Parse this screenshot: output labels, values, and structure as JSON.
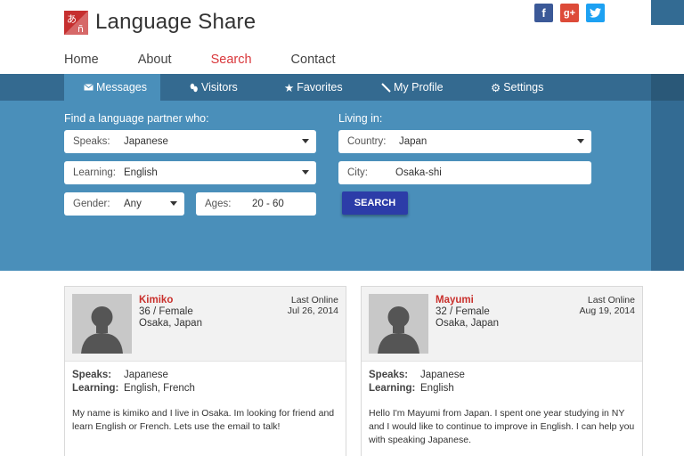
{
  "header": {
    "app_title": "Language Share",
    "logo_glyphs": {
      "top": "あ",
      "bottom": "ñ"
    },
    "social": [
      {
        "name": "facebook-icon",
        "glyph": "f"
      },
      {
        "name": "google-plus-icon",
        "glyph": "g+"
      },
      {
        "name": "twitter-icon",
        "glyph": "t"
      }
    ]
  },
  "topnav": [
    {
      "label": "Home"
    },
    {
      "label": "About"
    },
    {
      "label": "Search"
    },
    {
      "label": "Contact"
    }
  ],
  "tabs": [
    {
      "label": "Messages",
      "icon": "envelope-icon"
    },
    {
      "label": "Visitors",
      "icon": "footprints-icon"
    },
    {
      "label": "Favorites",
      "icon": "star-icon"
    },
    {
      "label": "My Profile",
      "icon": "pencil-icon"
    },
    {
      "label": "Settings",
      "icon": "gear-icon"
    }
  ],
  "search": {
    "find_label": "Find a language partner who:",
    "living_label": "Living in:",
    "speaks": {
      "label": "Speaks:",
      "value": "Japanese"
    },
    "learning": {
      "label": "Learning:",
      "value": "English"
    },
    "gender": {
      "label": "Gender:",
      "value": "Any"
    },
    "ages": {
      "label": "Ages:",
      "value": "20 - 60"
    },
    "country": {
      "label": "Country:",
      "value": "Japan"
    },
    "city": {
      "label": "City:",
      "value": "Osaka-shi"
    },
    "button": "SEARCH"
  },
  "results": [
    {
      "name": "Kimiko",
      "age_gender": "36 / Female",
      "location": "Osaka, Japan",
      "last_online_label": "Last Online",
      "last_online_date": "Jul 26, 2014",
      "speaks_label": "Speaks:",
      "speaks": "Japanese",
      "learning_label": "Learning:",
      "learning": "English, French",
      "bio": "My name is kimiko and I live in Osaka. Im looking for friend and learn English or French. Lets use the email to talk!"
    },
    {
      "name": "Mayumi",
      "age_gender": "32 / Female",
      "location": "Osaka, Japan",
      "last_online_label": "Last Online",
      "last_online_date": "Aug 19, 2014",
      "speaks_label": "Speaks:",
      "speaks": "Japanese",
      "learning_label": "Learning:",
      "learning": "English",
      "bio": "Hello I'm Mayumi from Japan. I spent one year studying in NY and I would like to continue to improve in English. I can help you with speaking Japanese."
    }
  ],
  "colors": {
    "brand_red": "#c62f2f",
    "panel_blue": "#4a8fba",
    "tab_bar": "#346a90",
    "search_button": "#2c3ca8",
    "active_nav": "#d9373b"
  }
}
